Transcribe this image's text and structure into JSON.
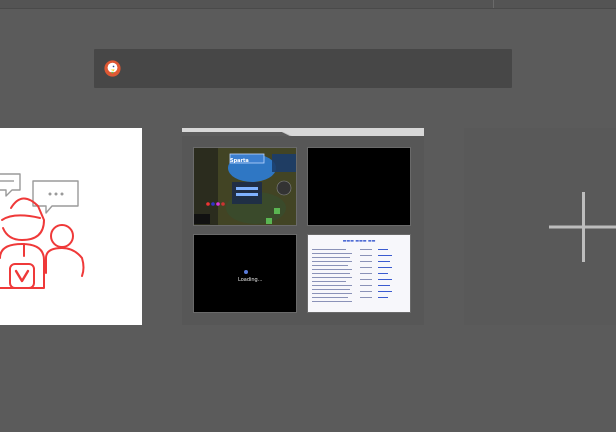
{
  "search": {
    "engine_icon": "duckduckgo-icon",
    "value": "",
    "placeholder": ""
  },
  "speed_dials": [
    {
      "type": "image",
      "illustration": "vivaldi-community-icon"
    },
    {
      "type": "folder",
      "thumbnails": [
        {
          "title": "Sparta",
          "kind": "game-screenshot"
        },
        {
          "kind": "black-page"
        },
        {
          "kind": "loading-page",
          "text": "Loading..."
        },
        {
          "kind": "document-page"
        }
      ]
    },
    {
      "type": "add",
      "icon": "plus-icon"
    }
  ],
  "colors": {
    "background": "#5b5b5b",
    "search_bar": "#474747",
    "accent_red": "#ef3939",
    "add_icon": "#bdbdbd"
  }
}
